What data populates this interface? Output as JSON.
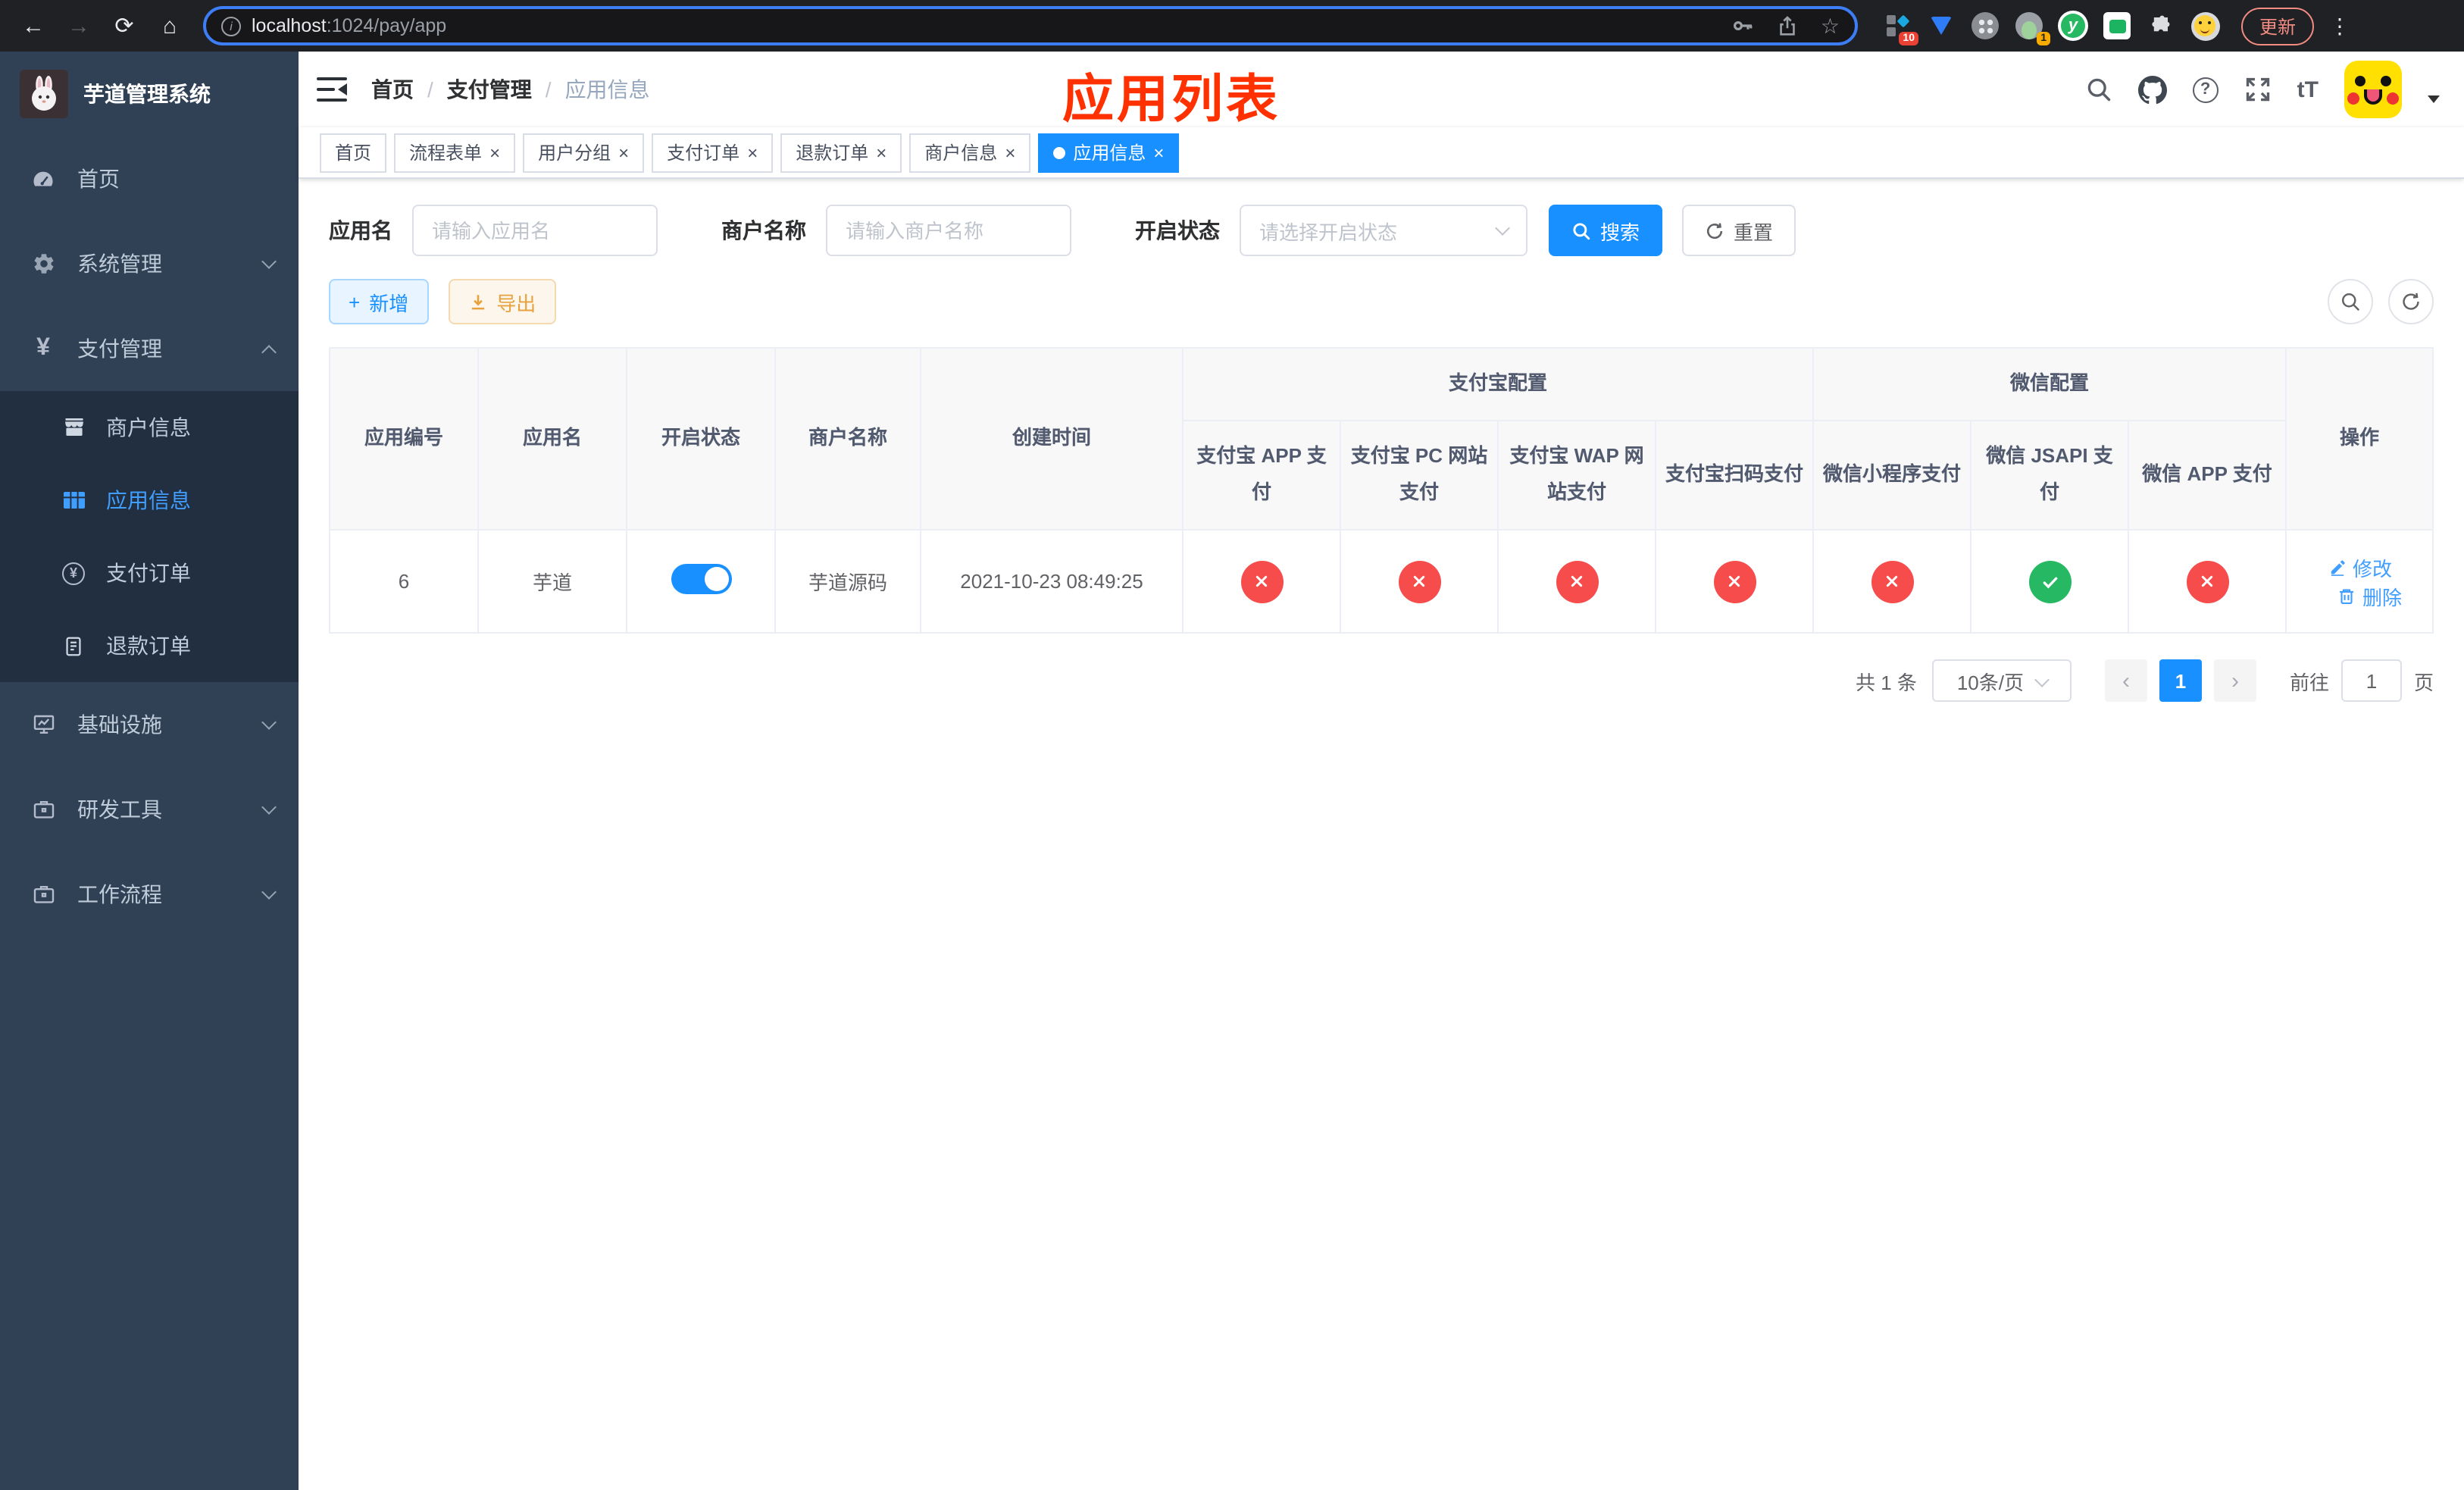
{
  "browser": {
    "url_host": "localhost",
    "url_rest": ":1024/pay/app",
    "update_label": "更新",
    "ext_badge_count": "10",
    "ext_avatar_badge": "1"
  },
  "icons": {
    "back": "←",
    "forward": "→",
    "reload": "⟳",
    "home": "⌂",
    "info": "i",
    "star": "☆",
    "menu_dots": "⋮",
    "yen": "¥",
    "plus": "+",
    "question": "?",
    "font_size": "tT",
    "close": "×",
    "prev": "‹",
    "next": "›",
    "ext_y": "y"
  },
  "sidebar": {
    "title": "芋道管理系统",
    "menu": [
      {
        "label": "首页"
      },
      {
        "label": "系统管理"
      },
      {
        "label": "支付管理"
      },
      {
        "label": "基础设施"
      },
      {
        "label": "研发工具"
      },
      {
        "label": "工作流程"
      }
    ],
    "submenu": [
      {
        "label": "商户信息"
      },
      {
        "label": "应用信息",
        "active": true
      },
      {
        "label": "支付订单"
      },
      {
        "label": "退款订单"
      }
    ]
  },
  "header": {
    "breadcrumb": [
      "首页",
      "支付管理",
      "应用信息"
    ],
    "annotation": "应用列表"
  },
  "tabs": [
    {
      "label": "首页",
      "closable": false,
      "active": false
    },
    {
      "label": "流程表单",
      "closable": true,
      "active": false
    },
    {
      "label": "用户分组",
      "closable": true,
      "active": false
    },
    {
      "label": "支付订单",
      "closable": true,
      "active": false
    },
    {
      "label": "退款订单",
      "closable": true,
      "active": false
    },
    {
      "label": "商户信息",
      "closable": true,
      "active": false
    },
    {
      "label": "应用信息",
      "closable": true,
      "active": true
    }
  ],
  "filters": {
    "app_name_label": "应用名",
    "app_name_placeholder": "请输入应用名",
    "merchant_label": "商户名称",
    "merchant_placeholder": "请输入商户名称",
    "status_label": "开启状态",
    "status_placeholder": "请选择开启状态",
    "search_label": "搜索",
    "reset_label": "重置"
  },
  "toolbar": {
    "add_label": "新增",
    "export_label": "导出"
  },
  "table": {
    "columns": {
      "app_id": "应用编号",
      "app_name": "应用名",
      "status": "开启状态",
      "merchant": "商户名称",
      "created": "创建时间",
      "alipay_group": "支付宝配置",
      "wechat_group": "微信配置",
      "alipay_app": "支付宝 APP 支付",
      "alipay_pc": "支付宝 PC 网站支付",
      "alipay_wap": "支付宝 WAP 网站支付",
      "alipay_qr": "支付宝扫码支付",
      "wx_lite": "微信小程序支付",
      "wx_jsapi": "微信 JSAPI 支付",
      "wx_app": "微信 APP 支付",
      "actions": "操作"
    },
    "row": {
      "app_id": "6",
      "app_name": "芋道",
      "status_on": true,
      "merchant": "芋道源码",
      "created": "2021-10-23 08:49:25",
      "alipay_app": false,
      "alipay_pc": false,
      "alipay_wap": false,
      "alipay_qr": false,
      "wx_lite": false,
      "wx_jsapi": true,
      "wx_app": false,
      "edit_label": "修改",
      "delete_label": "删除"
    }
  },
  "pagination": {
    "total": "共 1 条",
    "page_size": "10条/页",
    "page": "1",
    "goto_label": "前往",
    "goto_value": "1",
    "page_unit": "页"
  },
  "colors": {
    "primary": "#1890ff",
    "link": "#409eff",
    "danger": "#f64c4c",
    "success": "#26b862",
    "warning": "#e6a23c",
    "annotation": "#ff3100",
    "sidebar_bg": "#304156",
    "submenu_bg": "#212f41"
  }
}
